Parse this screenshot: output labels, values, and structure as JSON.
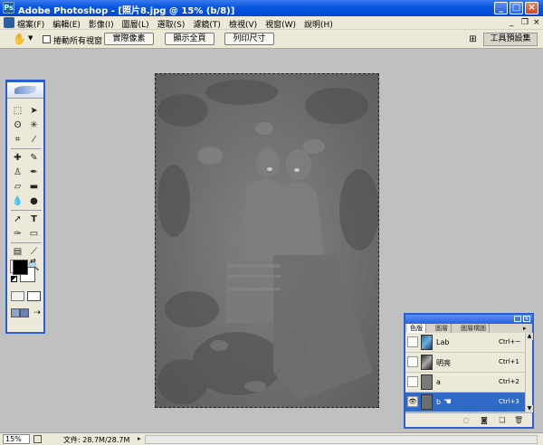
{
  "window": {
    "title": "Adobe Photoshop - [照片8.jpg @ 15% (b/8)]",
    "minimize": "_",
    "maximize": "□",
    "close": "×"
  },
  "menu": {
    "items": [
      "檔案(F)",
      "編輯(E)",
      "影像(I)",
      "圖層(L)",
      "選取(S)",
      "濾鏡(T)",
      "檢視(V)",
      "視窗(W)",
      "說明(H)"
    ],
    "doc_minimize": "_",
    "doc_restore": "❐",
    "doc_close": "×"
  },
  "options_bar": {
    "scroll_all_label": "捲動所有視窗",
    "buttons": [
      "實際像素",
      "顯示全頁",
      "列印尺寸"
    ],
    "palette_well": "工具預設集"
  },
  "channels_panel": {
    "tabs": [
      "色版",
      "圖層",
      "圖層構圖"
    ],
    "channels": [
      {
        "name": "Lab",
        "shortcut": "Ctrl+~",
        "visible": false,
        "selected": false
      },
      {
        "name": "明亮",
        "shortcut": "Ctrl+1",
        "visible": false,
        "selected": false
      },
      {
        "name": "a",
        "shortcut": "Ctrl+2",
        "visible": false,
        "selected": false
      },
      {
        "name": "b",
        "shortcut": "Ctrl+3",
        "visible": true,
        "selected": true
      }
    ]
  },
  "status": {
    "zoom": "15%",
    "doc_size": "文件: 28.7M/28.7M"
  },
  "colors": {
    "title_blue": "#0a58e0",
    "selection": "#3169c6",
    "canvas_gray": "#717171",
    "foreground": "#000000",
    "background": "#ffffff"
  }
}
